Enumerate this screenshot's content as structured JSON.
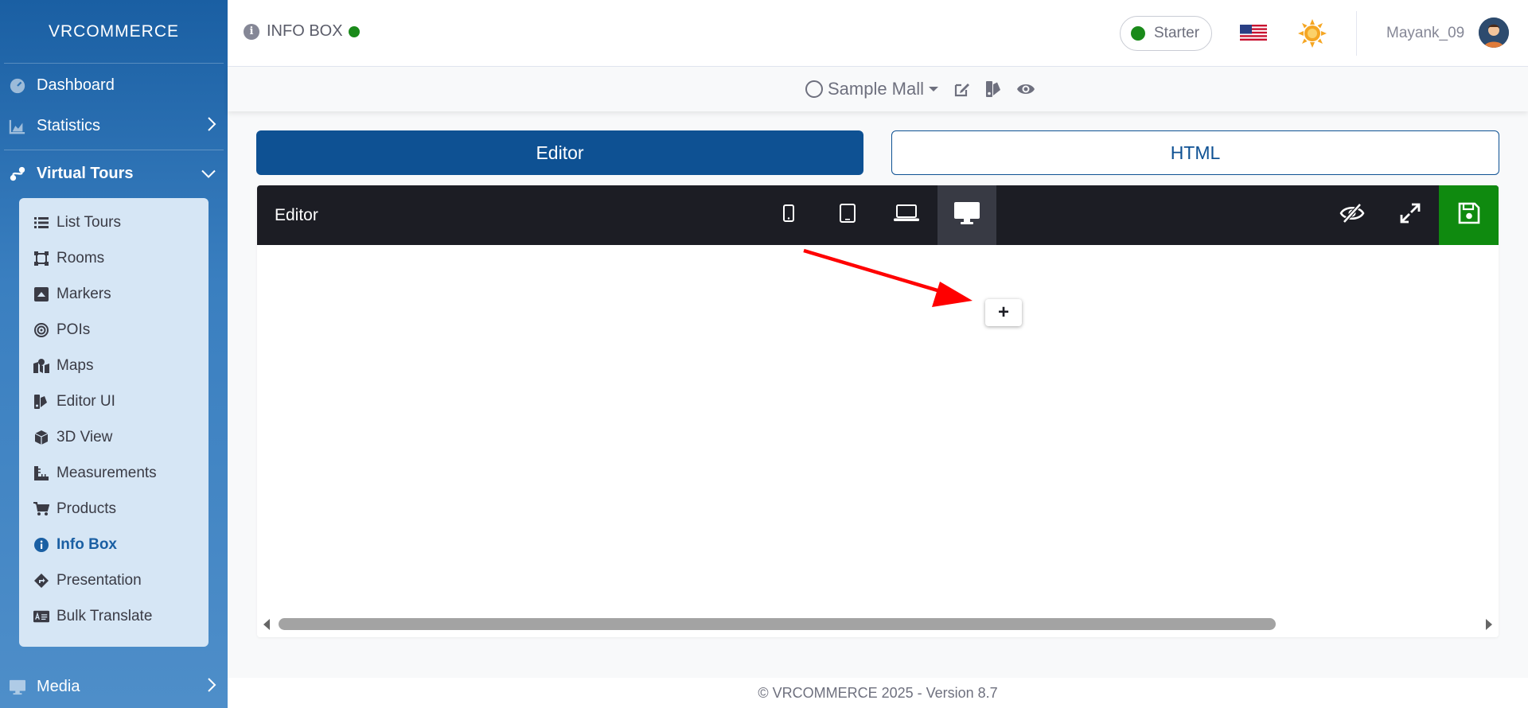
{
  "brand": {
    "logo_text": "VRCOMMERCE"
  },
  "sidebar": {
    "dashboard": "Dashboard",
    "statistics": "Statistics",
    "virtual_tours": "Virtual Tours",
    "media": "Media",
    "submenu": [
      {
        "label": "List Tours",
        "icon": "list-icon"
      },
      {
        "label": "Rooms",
        "icon": "vector-square-icon"
      },
      {
        "label": "Markers",
        "icon": "caret-square-icon"
      },
      {
        "label": "POIs",
        "icon": "bullseye-icon"
      },
      {
        "label": "Maps",
        "icon": "map-marked-icon"
      },
      {
        "label": "Editor UI",
        "icon": "swatchbook-icon"
      },
      {
        "label": "3D View",
        "icon": "cube-icon"
      },
      {
        "label": "Measurements",
        "icon": "ruler-icon"
      },
      {
        "label": "Products",
        "icon": "shopping-cart-icon"
      },
      {
        "label": "Info Box",
        "icon": "info-circle-icon"
      },
      {
        "label": "Presentation",
        "icon": "directions-icon"
      },
      {
        "label": "Bulk Translate",
        "icon": "language-icon"
      }
    ],
    "active_item": "Info Box"
  },
  "topbar": {
    "page_title": "INFO BOX",
    "plan": "Starter",
    "username": "Mayank_09"
  },
  "tourbar": {
    "selected_tour": "Sample Mall"
  },
  "mode_buttons": {
    "editor": "Editor",
    "html": "HTML",
    "active": "Editor"
  },
  "editor": {
    "title": "Editor",
    "devices": [
      "mobile",
      "tablet",
      "laptop",
      "desktop"
    ],
    "active_device": "desktop",
    "add_button": "+"
  },
  "footer": {
    "text": "© VRCOMMERCE 2025 - Version 8.7"
  },
  "colors": {
    "primary": "#0e5193",
    "save_green": "#0f8a0f",
    "toolbar_dark": "#1c1d24",
    "status_green": "#1a8a1a",
    "arrow_red": "#ff0000"
  }
}
